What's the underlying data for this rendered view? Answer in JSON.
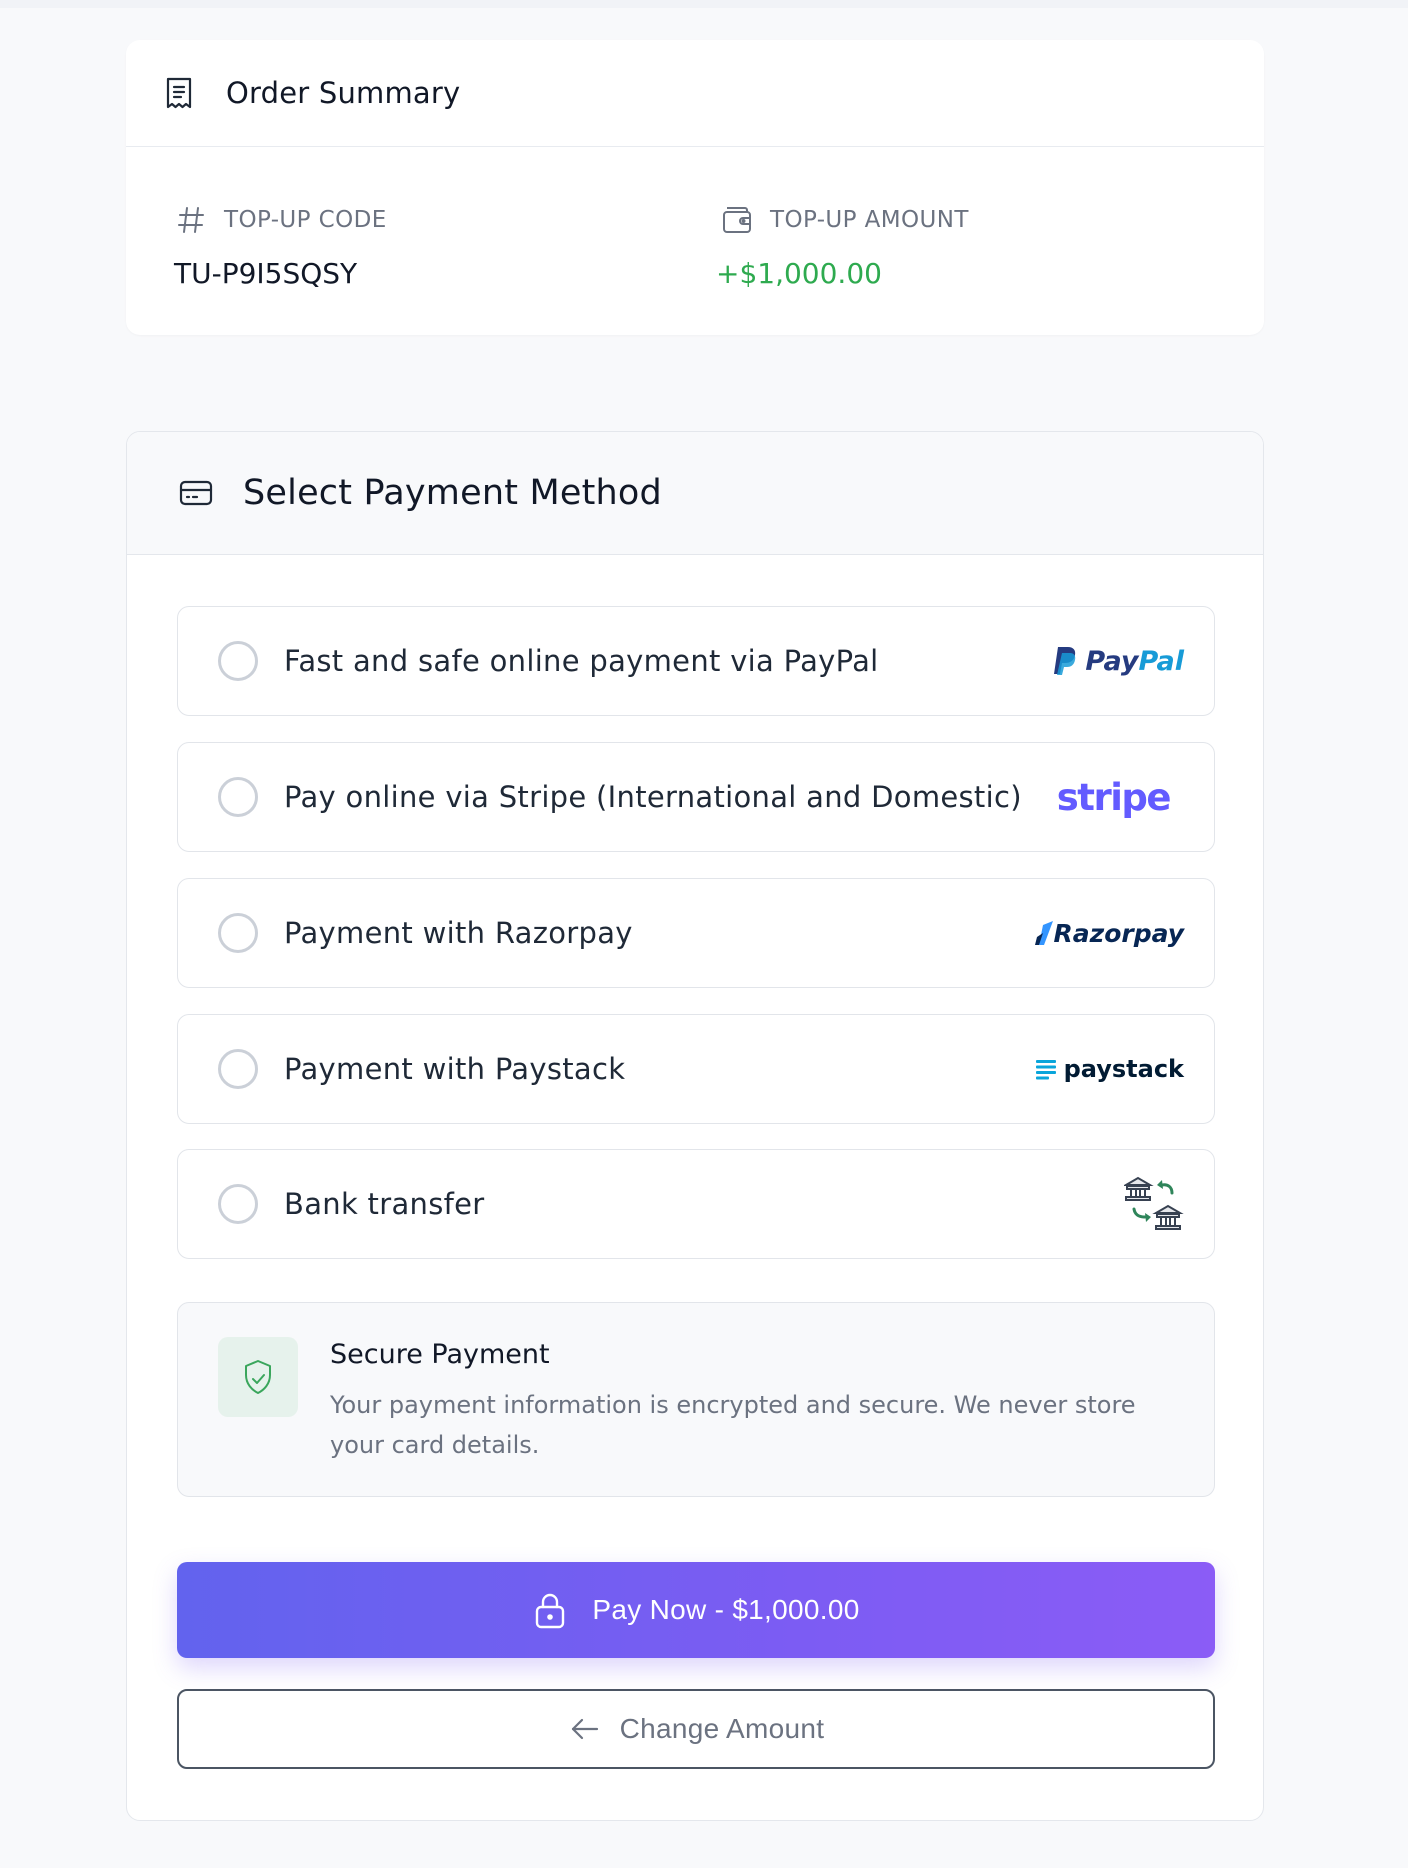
{
  "order_summary": {
    "title": "Order Summary",
    "code_label": "TOP-UP CODE",
    "code_value": "TU-P9I5SQSY",
    "amount_label": "TOP-UP AMOUNT",
    "amount_value": "+$1,000.00",
    "amount_color": "#2eaa4f"
  },
  "payment": {
    "title": "Select Payment Method",
    "methods": [
      {
        "label": "Fast and safe online payment via PayPal",
        "logo_pay": "Pay",
        "logo_pal": "Pal",
        "selected": false
      },
      {
        "label": "Pay online via Stripe (International and Domestic)",
        "logo": "stripe",
        "selected": false
      },
      {
        "label": "Payment with Razorpay",
        "logo": "Razorpay",
        "selected": false
      },
      {
        "label": "Payment with Paystack",
        "logo": "paystack",
        "selected": false
      },
      {
        "label": "Bank transfer",
        "logo_icon": "bank-transfer-icon",
        "selected": false
      }
    ],
    "secure": {
      "title": "Secure Payment",
      "text": "Your payment information is encrypted and secure. We never store your card details."
    },
    "pay_button": "Pay Now - $1,000.00",
    "change_button": "Change Amount",
    "accent_gradient": [
      "#6263ee",
      "#8b5cf6"
    ]
  }
}
